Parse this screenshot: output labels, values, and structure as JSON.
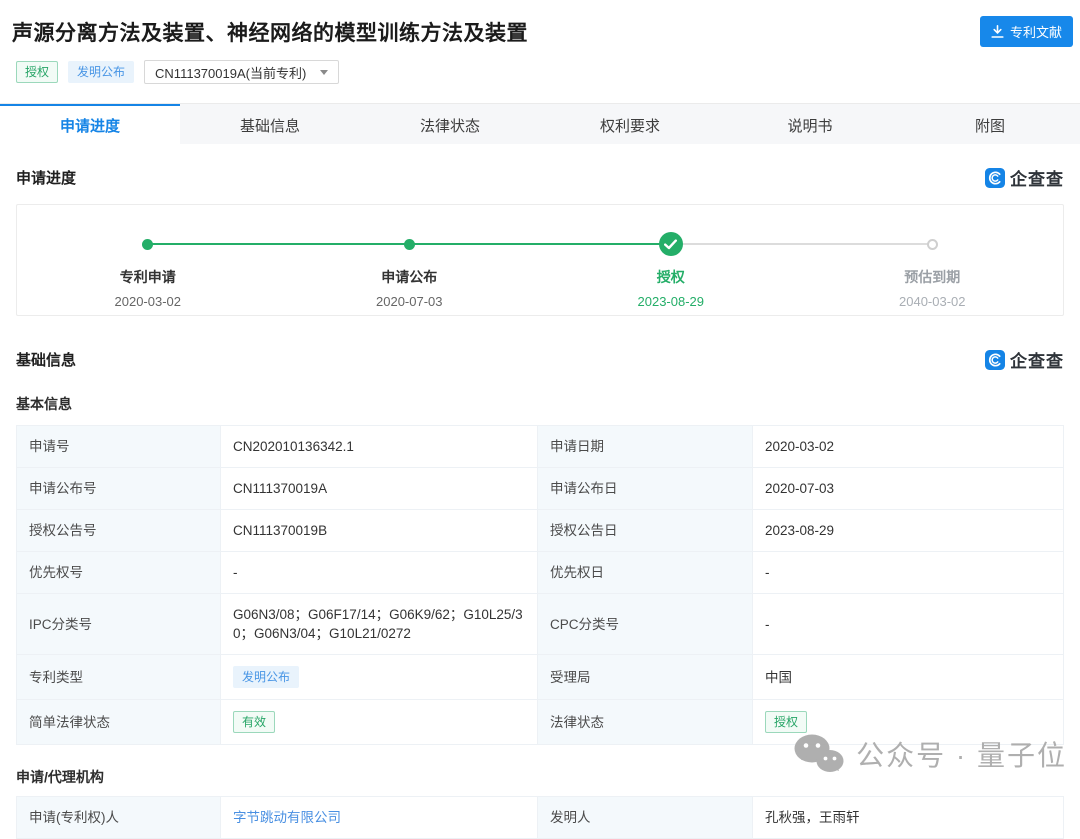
{
  "header": {
    "title": "声源分离方法及装置、神经网络的模型训练方法及装置",
    "status_tag": "授权",
    "type_tag": "发明公布",
    "patent_select_value": "CN111370019A(当前专利)",
    "doc_button_label": "专利文献"
  },
  "brand": {
    "logo_text": "企查查"
  },
  "tabs": [
    "申请进度",
    "基础信息",
    "法律状态",
    "权利要求",
    "说明书",
    "附图"
  ],
  "active_tab": "申请进度",
  "progress": {
    "section_title": "申请进度",
    "steps": [
      {
        "label": "专利申请",
        "date": "2020-03-02",
        "state": "done"
      },
      {
        "label": "申请公布",
        "date": "2020-07-03",
        "state": "done"
      },
      {
        "label": "授权",
        "date": "2023-08-29",
        "state": "granted"
      },
      {
        "label": "预估到期",
        "date": "2040-03-02",
        "state": "future"
      }
    ]
  },
  "basic_info": {
    "section_title": "基础信息",
    "subsection_title": "基本信息",
    "rows": [
      {
        "label1": "申请号",
        "value1": "CN202010136342.1",
        "label2": "申请日期",
        "value2": "2020-03-02"
      },
      {
        "label1": "申请公布号",
        "value1": "CN111370019A",
        "label2": "申请公布日",
        "value2": "2020-07-03"
      },
      {
        "label1": "授权公告号",
        "value1": "CN111370019B",
        "label2": "授权公告日",
        "value2": "2023-08-29"
      },
      {
        "label1": "优先权号",
        "value1": "-",
        "label2": "优先权日",
        "value2": "-"
      },
      {
        "label1": "IPC分类号",
        "value1": "G06N3/08；G06F17/14；G06K9/62；G10L25/30；G06N3/04；G10L21/0272",
        "label2": "CPC分类号",
        "value2": "-"
      },
      {
        "label1": "专利类型",
        "value1_tag": "发明公布",
        "label2": "受理局",
        "value2": "中国"
      },
      {
        "label1": "简单法律状态",
        "value1_tag": "有效",
        "label2": "法律状态",
        "value2_tag": "授权"
      }
    ]
  },
  "agency": {
    "subsection_title": "申请/代理机构",
    "rows": [
      {
        "label1": "申请(专利权)人",
        "value1_link": "字节跳动有限公司",
        "label2": "发明人",
        "value2": "孔秋强，王雨轩"
      }
    ]
  },
  "watermark": {
    "text": "公众号 · 量子位"
  },
  "colors": {
    "accent_blue": "#1788ea",
    "tab_active_blue": "#1584e6",
    "timeline_green": "#24ae68",
    "tag_green": "#27a567",
    "tag_blue": "#4895e5",
    "link_blue": "#4a90e2",
    "label_cell_bg": "#f4f9fc"
  }
}
